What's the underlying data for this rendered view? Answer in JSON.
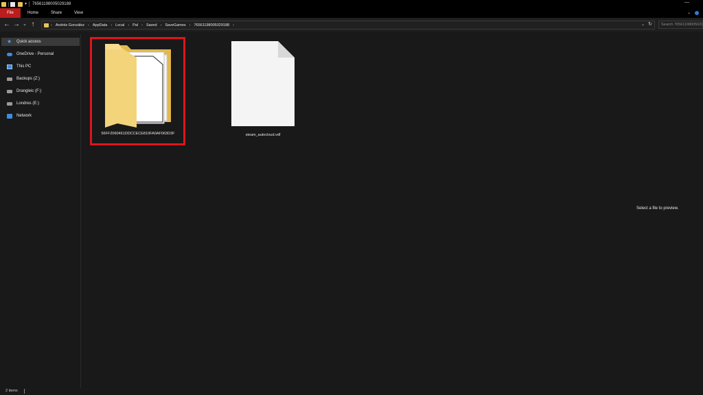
{
  "window": {
    "title": "76561198005029188",
    "minimize_glyph": "—"
  },
  "ribbon": {
    "tabs": [
      "File",
      "Home",
      "Share",
      "View"
    ],
    "accent_color": "#b91d1d"
  },
  "address_bar": {
    "breadcrumbs": [
      "Andrés González",
      "AppData",
      "Local",
      "Pal",
      "Saved",
      "SaveGames",
      "76561198005029188"
    ]
  },
  "search": {
    "placeholder": "Search 76561198005029188"
  },
  "sidebar": {
    "items": [
      {
        "label": "Quick access",
        "icon": "star-icon",
        "selected": true
      },
      {
        "label": "OneDrive - Personal",
        "icon": "cloud-icon",
        "selected": false
      },
      {
        "label": "This PC",
        "icon": "computer-icon",
        "selected": false
      },
      {
        "label": "Backups (Z:)",
        "icon": "drive-icon",
        "selected": false
      },
      {
        "label": "Drangleic (F:)",
        "icon": "drive-icon",
        "selected": false
      },
      {
        "label": "Londres (E:)",
        "icon": "drive-icon",
        "selected": false
      },
      {
        "label": "Network",
        "icon": "network-icon",
        "selected": false
      }
    ]
  },
  "files": [
    {
      "name": "56FF2060461DDCCECE810FA0AF063D3F",
      "type": "folder",
      "highlighted": true
    },
    {
      "name": "steam_autocloud.vdf",
      "type": "file",
      "highlighted": false
    }
  ],
  "preview": {
    "message": "Select a file to preview."
  },
  "status": {
    "item_count": "2 items"
  },
  "colors": {
    "highlight_border": "#e0141b",
    "folder_yellow": "#f0cf6e",
    "background": "#191919"
  }
}
